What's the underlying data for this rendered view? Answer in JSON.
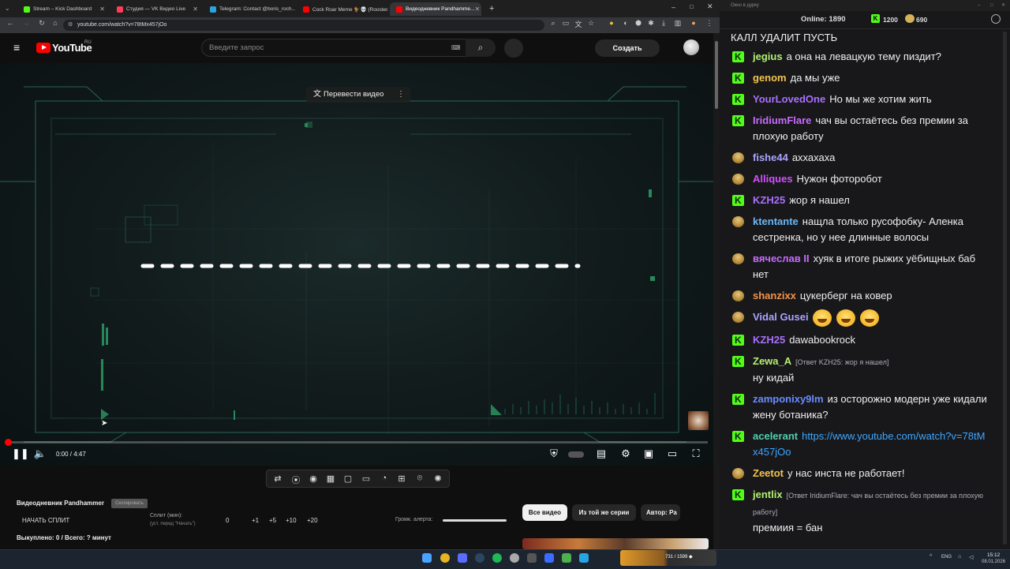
{
  "browser": {
    "tabs": [
      {
        "title": "Stream – Kick Dashboard",
        "color": "#53fc18",
        "active": false
      },
      {
        "title": "Студия — VK Видео Live",
        "color": "#ff3d5a",
        "active": false
      },
      {
        "title": "Telegram: Contact @boris_roch...",
        "color": "#2aa3e0",
        "active": false
      },
      {
        "title": "Cock Roar Meme 🐓💀 (Rooster...",
        "color": "#ff0000",
        "active": false
      },
      {
        "title": "Видеодневник Pandhamme...",
        "color": "#ff0000",
        "active": true
      }
    ],
    "url": "youtube.com/watch?v=78tMx457jOo"
  },
  "youtube": {
    "logo_text": "YouTube",
    "region": "RU",
    "search_placeholder": "Введите запрос",
    "create_label": "Создать",
    "translate_label": "Перевести видео",
    "time_display": "0:00 / 4:47"
  },
  "panel": {
    "channel_name": "Видеодневник Pandhammer",
    "copy_label": "Скопировать",
    "start_split": "НАЧАТЬ СПЛИТ",
    "split_label": "Сплит (мин):",
    "split_hint": "(уст. перед \"Начать\")",
    "split_value": "0",
    "increments": [
      "+1",
      "+5",
      "+10",
      "+20"
    ],
    "alert_label": "Громк. алерта:",
    "stats": "Выкуплено: 0 / Всего: ? минут",
    "chips": [
      "Все видео",
      "Из той же серии",
      "Автор: Pa"
    ]
  },
  "chat": {
    "window_title": "Окно в дурку",
    "online_label": "Online:",
    "online_count": "1890",
    "points_kick": "1200",
    "points_other": "690",
    "top_line": "КАЛЛ УДАЛИТ ПУСТЬ",
    "messages": [
      {
        "user": "jegius",
        "color": "#b4f06e",
        "badge": "kick",
        "text": "а она на левацкую тему пиздит?"
      },
      {
        "user": "genom",
        "color": "#f3c34c",
        "badge": "kick",
        "text": "да мы уже"
      },
      {
        "user": "YourLovedOne",
        "color": "#a970ff",
        "badge": "kick",
        "text": "Но мы же хотим жить"
      },
      {
        "user": "IridiumFlare",
        "color": "#c86bff",
        "badge": "kick",
        "text": "чач вы остаётесь без премии за плохую работу"
      },
      {
        "user": "fishe44",
        "color": "#a9a4ff",
        "badge": "bust",
        "text": "аххахаха"
      },
      {
        "user": "Alliques",
        "color": "#d44fff",
        "badge": "bust",
        "text": "Нужон фоторобот"
      },
      {
        "user": "KZH25",
        "color": "#a970ff",
        "badge": "kick",
        "text": "жор я нашел"
      },
      {
        "user": "ktentante",
        "color": "#6ab7f5",
        "badge": "bust",
        "text": "нащла только русофобку- Аленка сестренка, но у нее длинные волосы"
      },
      {
        "user": "вячеслав II",
        "color": "#c86bff",
        "badge": "bust",
        "text": "хуяк в итоге рыжих уёбищных баб нет"
      },
      {
        "user": "shanzixx",
        "color": "#f5934a",
        "badge": "bust",
        "text": "цукерберг на ковер"
      },
      {
        "user": "Vidal Gusei",
        "color": "#a9a4ff",
        "badge": "bust",
        "text": "",
        "emotes": 3
      },
      {
        "user": "KZH25",
        "color": "#a970ff",
        "badge": "kick",
        "text": "dawabookrock"
      },
      {
        "user": "Zewa_A",
        "color": "#b4f06e",
        "badge": "kick",
        "reply": "[Ответ KZH25: жор я нашел]",
        "text": "ну кидай"
      },
      {
        "user": "zamponixy9lm",
        "color": "#6a8cff",
        "badge": "kick",
        "text": "из осторожно модерн уже кидали жену ботаника?"
      },
      {
        "user": "acelerant",
        "color": "#4fd0b0",
        "badge": "kick",
        "text": "https://www.youtube.com/watch?v=78tMx457jOo",
        "is_link": true
      },
      {
        "user": "Zeetot",
        "color": "#f3c34c",
        "badge": "bust",
        "text": "у нас инста  не работает!"
      },
      {
        "user": "jentlix",
        "color": "#b4f06e",
        "badge": "kick",
        "reply": "[Ответ IridiumFlare: чач вы остаётесь без премии за плохую работу]",
        "text": "премиия = бан"
      }
    ]
  },
  "taskbar": {
    "meme_text": "731 / 1599 ◆",
    "tray": "ENG",
    "clock_time": "15:12",
    "clock_date": "08.01.2026"
  }
}
